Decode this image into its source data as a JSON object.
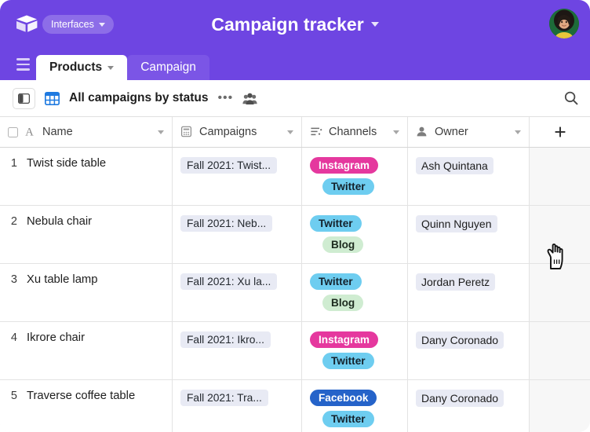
{
  "brand": {
    "logo_icon": "airtable-cube-icon",
    "header_bg": "#6e45e2"
  },
  "header": {
    "interfaces_label": "Interfaces",
    "title": "Campaign tracker",
    "avatar_name": "user-avatar"
  },
  "tabs": [
    {
      "label": "Products",
      "active": true,
      "has_caret": true
    },
    {
      "label": "Campaign",
      "active": false,
      "has_caret": false
    }
  ],
  "toolbar": {
    "sidebar_toggle_icon": "sidebar-toggle-icon",
    "view_icon": "grid-view-icon",
    "view_name": "All campaigns by status",
    "more_label": "•••",
    "collaborators_icon": "people-icon",
    "search_icon": "search-icon"
  },
  "table": {
    "columns": [
      {
        "label": "Name",
        "icon": "text-field-icon"
      },
      {
        "label": "Campaigns",
        "icon": "linked-record-icon"
      },
      {
        "label": "Channels",
        "icon": "multi-select-icon"
      },
      {
        "label": "Owner",
        "icon": "user-field-icon"
      }
    ],
    "add_field_label": "+",
    "chip_colors": {
      "Instagram": {
        "bg": "#e5389e",
        "fg": "#ffffff"
      },
      "Twitter": {
        "bg": "#6ecdf0",
        "fg": "#14212b"
      },
      "Blog": {
        "bg": "#cfecd1",
        "fg": "#1d2b1f"
      },
      "Facebook": {
        "bg": "#2563c9",
        "fg": "#ffffff"
      }
    },
    "rows": [
      {
        "num": "1",
        "name": "Twist side table",
        "campaign": "Fall 2021: Twist...",
        "channels": [
          "Instagram",
          "Twitter"
        ],
        "owner": "Ash Quintana"
      },
      {
        "num": "2",
        "name": "Nebula chair",
        "campaign": "Fall 2021: Neb...",
        "channels": [
          "Twitter",
          "Blog"
        ],
        "owner": "Quinn Nguyen"
      },
      {
        "num": "3",
        "name": "Xu table lamp",
        "campaign": "Fall 2021: Xu la...",
        "channels": [
          "Twitter",
          "Blog"
        ],
        "owner": "Jordan Peretz"
      },
      {
        "num": "4",
        "name": "Ikrore chair",
        "campaign": "Fall 2021: Ikro...",
        "channels": [
          "Instagram",
          "Twitter"
        ],
        "owner": "Dany Coronado"
      },
      {
        "num": "5",
        "name": "Traverse coffee table",
        "campaign": "Fall 2021: Tra...",
        "channels": [
          "Facebook",
          "Twitter"
        ],
        "owner": "Dany Coronado"
      }
    ]
  }
}
